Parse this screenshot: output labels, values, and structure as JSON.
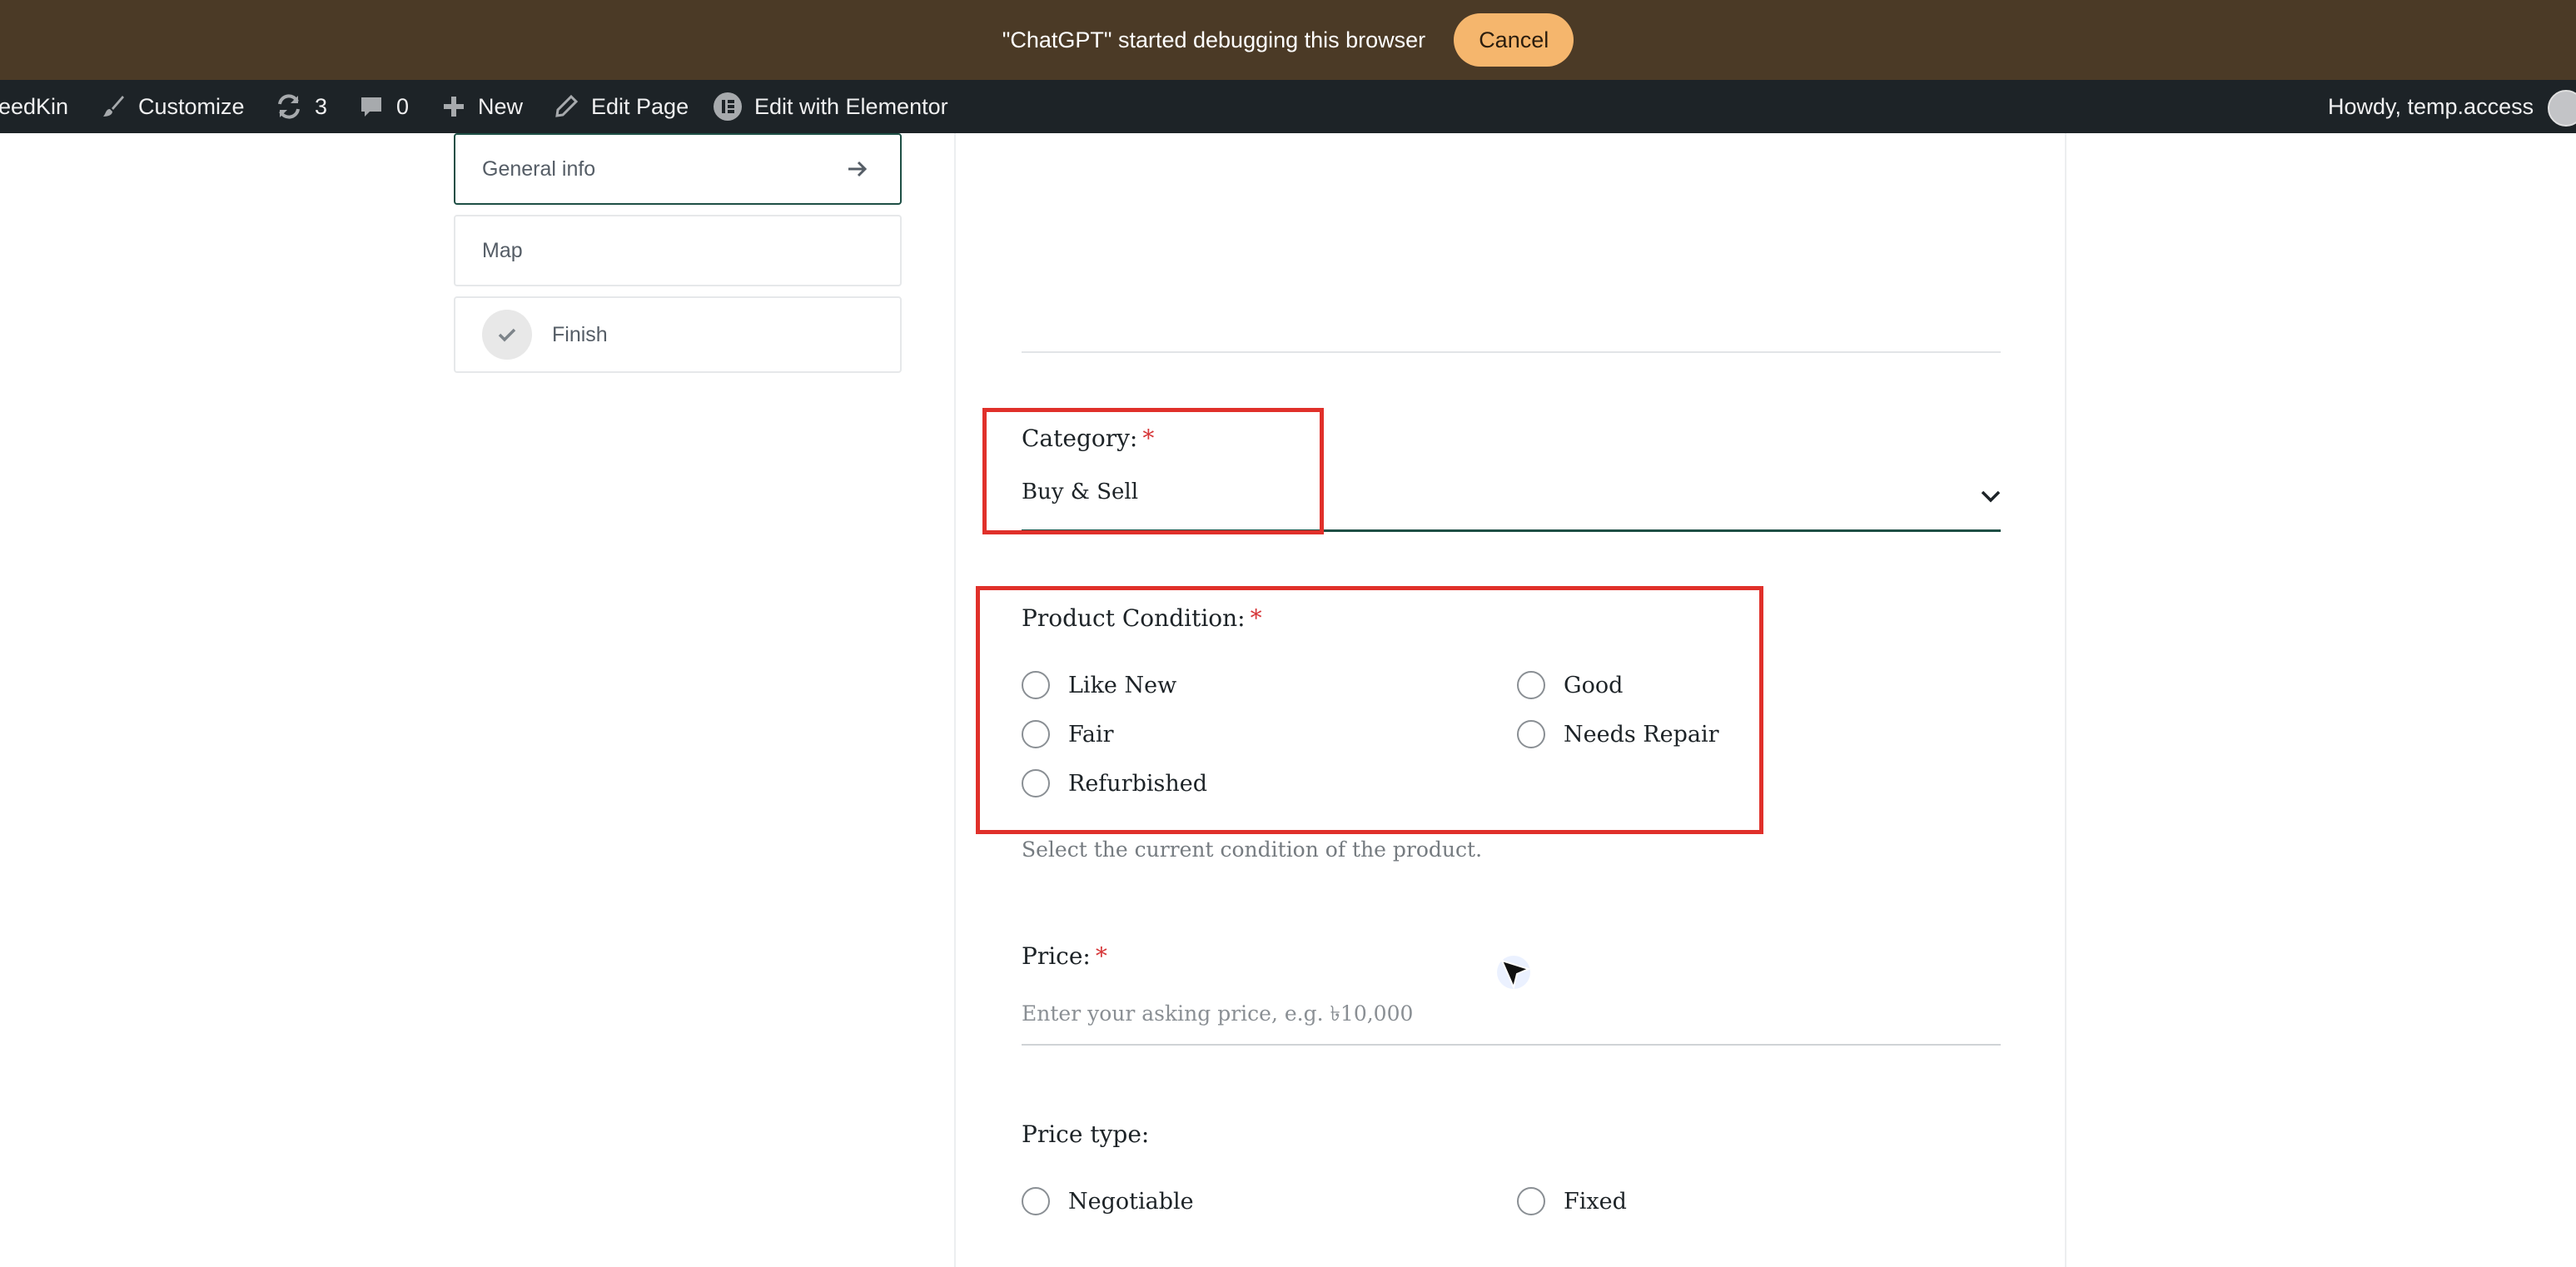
{
  "debug_banner": {
    "message": "\"ChatGPT\" started debugging this browser",
    "cancel_label": "Cancel"
  },
  "admin_bar": {
    "site_name": "leedKin",
    "customize": "Customize",
    "updates_count": "3",
    "comments_count": "0",
    "new": "New",
    "edit_page": "Edit Page",
    "edit_elementor": "Edit with Elementor",
    "howdy": "Howdy, temp.access"
  },
  "steps": [
    {
      "label": "General info",
      "active": true
    },
    {
      "label": "Map",
      "active": false
    },
    {
      "label": "Finish",
      "active": false
    }
  ],
  "form": {
    "category": {
      "label": "Category:",
      "required_mark": "*",
      "value": "Buy & Sell"
    },
    "condition": {
      "label": "Product Condition:",
      "required_mark": "*",
      "options": [
        "Like New",
        "Good",
        "Fair",
        "Needs Repair",
        "Refurbished"
      ],
      "hint": "Select the current condition of the product."
    },
    "price": {
      "label": "Price:",
      "required_mark": "*",
      "placeholder": "Enter your asking price, e.g. ৳10,000",
      "value": ""
    },
    "price_type": {
      "label": "Price type:",
      "options": [
        "Negotiable",
        "Fixed"
      ]
    }
  },
  "colors": {
    "banner_bg": "#4b3a26",
    "cancel_bg": "#f5b66d",
    "admin_bar_bg": "#1d2327",
    "accent": "#1e4f45",
    "required": "#d63638",
    "highlight": "#e0302a"
  }
}
